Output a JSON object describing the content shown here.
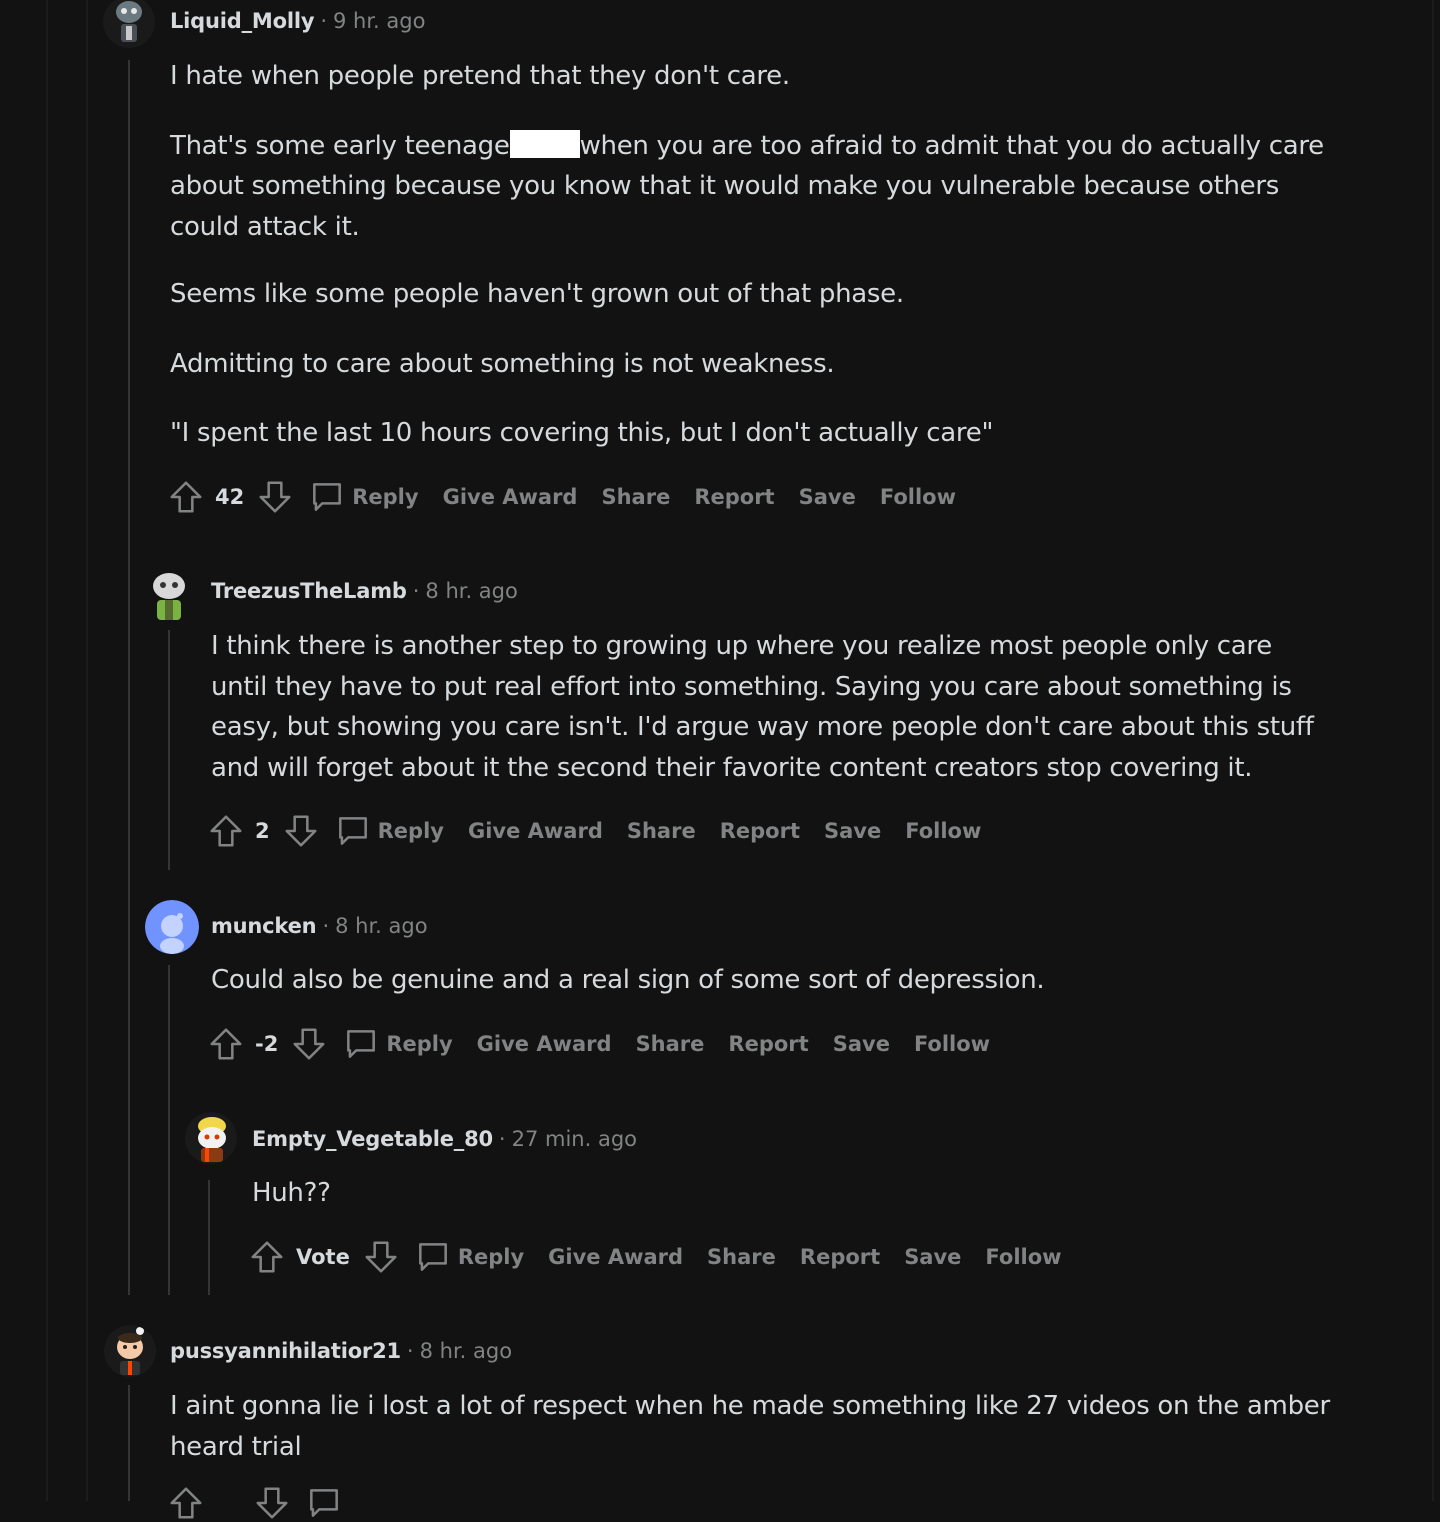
{
  "comments": [
    {
      "author": "Liquid_Molly",
      "time": "9 hr. ago",
      "paragraphs": [
        "I hate when people pretend that they don't care."
      ],
      "p2_before": "That's some early teenage",
      "p2_after": "when you are too afraid to admit that you do actually care",
      "p2_line2": "about something because you know that it would make you vulnerable because others",
      "p2_line3": "could attack it.",
      "p3": "Seems like some people haven't grown out of that phase.",
      "p4": "Admitting to care about something is not weakness.",
      "p5": "\"I spent the last 10 hours covering this, but I don't actually care\"",
      "score": "42"
    },
    {
      "author": "TreezusTheLamb",
      "time": "8 hr. ago",
      "lines": [
        "I think there is another step to growing up where you realize most people only care",
        "until they have to put real effort into something. Saying you care about something is",
        "easy, but showing you care isn't. I'd argue way more people don't care about this stuff",
        "and will forget about it the second their favorite content creators stop covering it."
      ],
      "score": "2"
    },
    {
      "author": "muncken",
      "time": "8 hr. ago",
      "lines": [
        "Could also be genuine and a real sign of some sort of depression."
      ],
      "score": "-2"
    },
    {
      "author": "Empty_Vegetable_80",
      "time": "27 min. ago",
      "lines": [
        "Huh??"
      ],
      "score": "Vote"
    },
    {
      "author": "pussyannihilatior21",
      "time": "8 hr. ago",
      "lines": [
        "I aint gonna lie i lost a lot of respect when he made something like 27 videos on the amber",
        "heard trial"
      ]
    }
  ],
  "actions": {
    "reply": "Reply",
    "give_award": "Give Award",
    "share": "Share",
    "report": "Report",
    "save": "Save",
    "follow": "Follow"
  },
  "separator": "·",
  "colors": {
    "background": "#121212",
    "text": "#d7dadc",
    "muted": "#818384",
    "thread_line": "#343536"
  },
  "icons": [
    "upvote-icon",
    "downvote-icon",
    "comment-bubble-icon",
    "avatar-icon"
  ]
}
